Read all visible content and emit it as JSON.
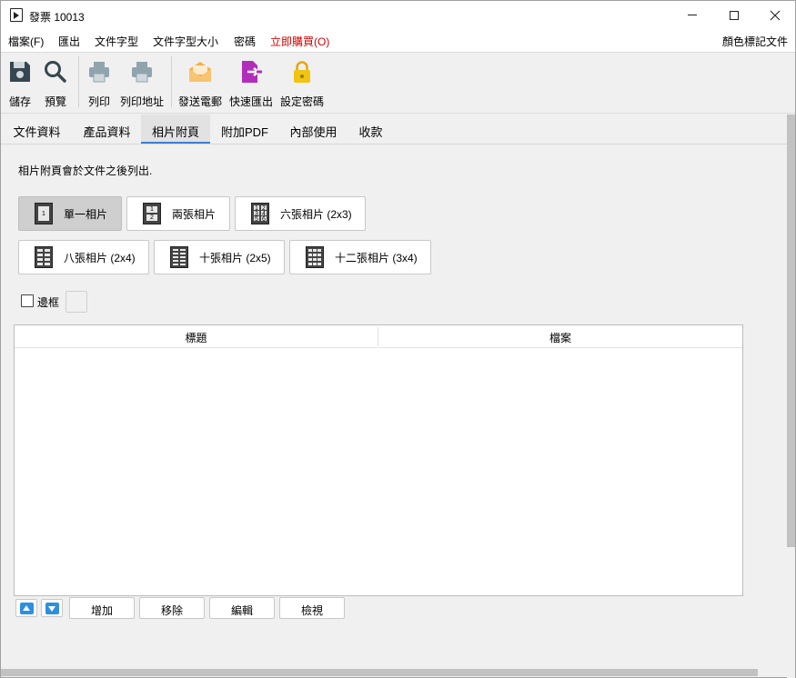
{
  "window": {
    "title": "發票 10013"
  },
  "menu": {
    "items": [
      "檔案(F)",
      "匯出",
      "文件字型",
      "文件字型大小",
      "密碼",
      "立即購買(O)"
    ],
    "right": "顏色標記文件"
  },
  "toolbar": {
    "save": "儲存",
    "preview": "預覽",
    "print": "列印",
    "print_address": "列印地址",
    "send_email": "發送電郵",
    "quick_export": "快速匯出",
    "set_password": "設定密碼"
  },
  "tabs": [
    "文件資料",
    "產品資料",
    "相片附頁",
    "附加PDF",
    "內部使用",
    "收款"
  ],
  "content": {
    "info": "相片附頁會於文件之後列出.",
    "layouts": [
      "單一相片",
      "兩張相片",
      "六張相片 (2x3)",
      "八張相片 (2x4)",
      "十張相片 (2x5)",
      "十二張相片 (3x4)"
    ],
    "border_label": "邊框",
    "table_headers": [
      "標題",
      "檔案"
    ],
    "buttons": {
      "add": "增加",
      "remove": "移除",
      "edit": "編輯",
      "view": "檢視"
    }
  },
  "colors": {
    "accent": "#3b7fd6",
    "menu_red": "#d40000",
    "arrow_blue": "#2d8fe0"
  }
}
